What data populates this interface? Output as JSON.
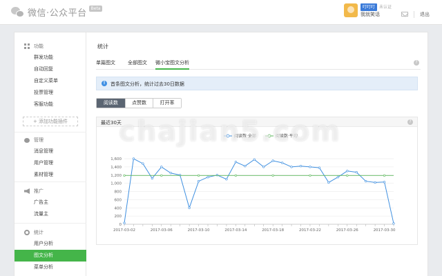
{
  "header": {
    "logo_text": "微信·公众平台",
    "beta_badge": "Beta",
    "account_name": "叮叮叮",
    "account_type": "未认证",
    "account_nick": "我就笑话",
    "logout_label": "退出"
  },
  "sidebar": {
    "groups": [
      {
        "title": "功能",
        "icon": "grid-icon",
        "items": [
          "群发功能",
          "自动回复",
          "自定义菜单",
          "投票管理",
          "客服功能"
        ]
      },
      {
        "title": "管理",
        "icon": "chat-icon",
        "items": [
          "消息管理",
          "用户管理",
          "素材管理"
        ]
      },
      {
        "title": "推广",
        "icon": "horn-icon",
        "items": [
          "广告主",
          "流量主"
        ]
      },
      {
        "title": "统计",
        "icon": "stats-icon",
        "items": [
          "用户分析",
          "图文分析",
          "菜单分析"
        ]
      }
    ],
    "add_plugin_label": "+ 添加功能插件",
    "active_item": "图文分析"
  },
  "content": {
    "page_title": "统计",
    "tabs": [
      "单篇图文",
      "全部图文",
      "微小宝图文分析"
    ],
    "active_tab": "微小宝图文分析",
    "notice": "首条图文分析，统计过去30日数据",
    "segments": [
      "阅读数",
      "点赞数",
      "打开率"
    ],
    "active_segment": "阅读数",
    "chart_header": "最近30天"
  },
  "colors": {
    "accent_green": "#44b549",
    "series_blue": "#3e8fe0",
    "average_green": "#5cb85c",
    "notice_bg": "#e4eef9"
  },
  "watermark": "chajian5.com",
  "chart_data": {
    "type": "line",
    "legend": [
      "阅读数·全部",
      "阅读数·平均"
    ],
    "legend_position": "top-center",
    "y_ticks": [
      "0",
      "200",
      "400",
      "600",
      "800",
      "1,000",
      "1,200",
      "1,400",
      "1,600"
    ],
    "ylim": [
      0,
      1600
    ],
    "x_tick_labels": [
      "2017-03-02",
      "2017-03-06",
      "2017-03-10",
      "2017-03-14",
      "2017-03-18",
      "2017-03-22",
      "2017-03-26",
      "2017-03-30"
    ],
    "x_start": "2017-03-02",
    "grid": true,
    "series": [
      {
        "name": "阅读数·全部",
        "values": [
          30,
          1600,
          1480,
          1120,
          1400,
          1250,
          1200,
          400,
          1050,
          1150,
          1200,
          1100,
          1520,
          1420,
          1580,
          1400,
          1550,
          1500,
          1400,
          1420,
          1400,
          1380,
          1020,
          1150,
          1300,
          1270,
          1050,
          1020,
          1030,
          20
        ]
      },
      {
        "name": "阅读数·平均",
        "values": [
          1190,
          1190,
          1190,
          1190,
          1190,
          1190,
          1190,
          1190,
          1190,
          1190,
          1190,
          1190,
          1190,
          1190,
          1190,
          1190,
          1190,
          1190,
          1190,
          1190,
          1190,
          1190,
          1190,
          1190,
          1190,
          1190,
          1190,
          1190,
          1190,
          1190
        ]
      }
    ]
  }
}
